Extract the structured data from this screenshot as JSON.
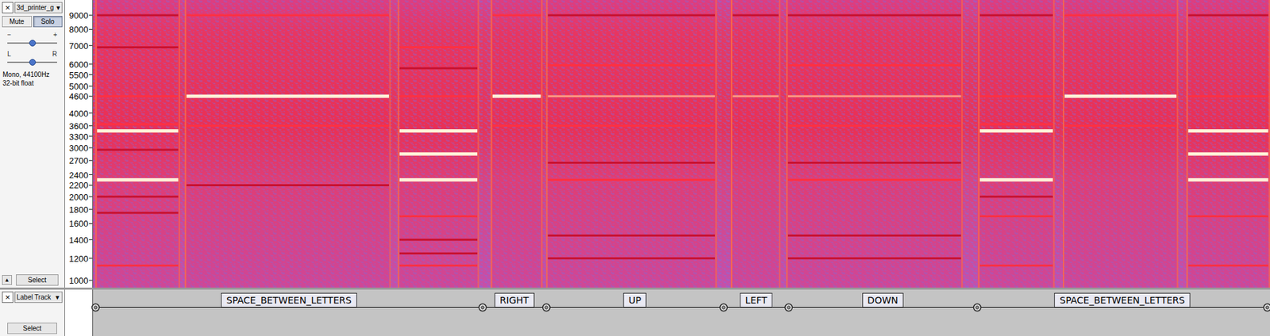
{
  "audio_track": {
    "close": "×",
    "name": "3d_printer_g",
    "menu_icon": "▼",
    "buttons": [
      {
        "label": "Mute",
        "selected": false
      },
      {
        "label": "Solo",
        "selected": true
      }
    ],
    "gain": {
      "min": "−",
      "max": "+",
      "level": 0.5
    },
    "pan": {
      "min": "L",
      "max": "R",
      "level": 0.5
    },
    "info": [
      "Mono, 44100Hz",
      "32-bit float"
    ],
    "collapse": "▲",
    "select": "Select",
    "ruler": {
      "ticks": [
        "9000",
        "8000",
        "7000",
        "6000",
        "5500",
        "5000",
        "4600",
        "4000",
        "3600",
        "3300",
        "3000",
        "2700",
        "2400",
        "2200",
        "2000",
        "1800",
        "1600",
        "1400",
        "1200",
        "1000"
      ]
    },
    "spectrogram": {
      "segments": [
        {
          "start": 0.002,
          "end": 0.074,
          "tones": [
            {
              "hz": 2300,
              "level": 1
            },
            {
              "hz": 3450,
              "level": 0.9
            },
            {
              "hz": 1130,
              "level": 0.55
            },
            {
              "hz": 4600,
              "level": 0.5
            },
            {
              "hz": 3650,
              "level": 0.45
            },
            {
              "hz": 2000,
              "level": 0.35
            },
            {
              "hz": 1750,
              "level": 0.35
            },
            {
              "hz": 2950,
              "level": 0.35
            },
            {
              "hz": 6900,
              "level": 0.35
            },
            {
              "hz": 9000,
              "level": 0.3
            }
          ]
        },
        {
          "start": 0.078,
          "end": 0.253,
          "tones": [
            {
              "hz": 4600,
              "level": 0.95
            },
            {
              "hz": 3600,
              "level": 0.5
            },
            {
              "hz": 9000,
              "level": 0.45
            },
            {
              "hz": 2200,
              "level": 0.3
            }
          ]
        },
        {
          "start": 0.259,
          "end": 0.328,
          "tones": [
            {
              "hz": 2300,
              "level": 1
            },
            {
              "hz": 2850,
              "level": 0.95
            },
            {
              "hz": 3450,
              "level": 0.9
            },
            {
              "hz": 1130,
              "level": 0.55
            },
            {
              "hz": 1700,
              "level": 0.4
            },
            {
              "hz": 1400,
              "level": 0.35
            },
            {
              "hz": 1250,
              "level": 0.35
            },
            {
              "hz": 4600,
              "level": 0.5
            },
            {
              "hz": 6900,
              "level": 0.4
            },
            {
              "hz": 5800,
              "level": 0.35
            }
          ]
        },
        {
          "start": 0.338,
          "end": 0.382,
          "tones": [
            {
              "hz": 4600,
              "level": 0.85
            },
            {
              "hz": 9000,
              "level": 0.4
            },
            {
              "hz": 3600,
              "level": 0.4
            }
          ]
        },
        {
          "start": 0.385,
          "end": 0.53,
          "tones": [
            {
              "hz": 4600,
              "level": 0.6
            },
            {
              "hz": 3600,
              "level": 0.5
            },
            {
              "hz": 5950,
              "level": 0.45
            },
            {
              "hz": 2300,
              "level": 0.4
            },
            {
              "hz": 1450,
              "level": 0.35
            },
            {
              "hz": 1200,
              "level": 0.3
            },
            {
              "hz": 9000,
              "level": 0.35
            },
            {
              "hz": 2650,
              "level": 0.3
            }
          ]
        },
        {
          "start": 0.542,
          "end": 0.584,
          "tones": [
            {
              "hz": 4600,
              "level": 0.75
            },
            {
              "hz": 9000,
              "level": 0.35
            }
          ]
        },
        {
          "start": 0.589,
          "end": 0.739,
          "tones": [
            {
              "hz": 4600,
              "level": 0.6
            },
            {
              "hz": 3600,
              "level": 0.5
            },
            {
              "hz": 5950,
              "level": 0.45
            },
            {
              "hz": 2300,
              "level": 0.4
            },
            {
              "hz": 1450,
              "level": 0.35
            },
            {
              "hz": 1200,
              "level": 0.3
            },
            {
              "hz": 9000,
              "level": 0.35
            },
            {
              "hz": 2650,
              "level": 0.3
            }
          ]
        },
        {
          "start": 0.752,
          "end": 0.817,
          "tones": [
            {
              "hz": 2300,
              "level": 1
            },
            {
              "hz": 3450,
              "level": 0.9
            },
            {
              "hz": 1700,
              "level": 0.5
            },
            {
              "hz": 1130,
              "level": 0.55
            },
            {
              "hz": 4600,
              "level": 0.45
            },
            {
              "hz": 3650,
              "level": 0.45
            },
            {
              "hz": 2000,
              "level": 0.35
            },
            {
              "hz": 9000,
              "level": 0.35
            }
          ]
        },
        {
          "start": 0.824,
          "end": 0.922,
          "tones": [
            {
              "hz": 4600,
              "level": 0.9
            },
            {
              "hz": 9000,
              "level": 0.45
            },
            {
              "hz": 3600,
              "level": 0.4
            }
          ]
        },
        {
          "start": 0.929,
          "end": 1.0,
          "tones": [
            {
              "hz": 2300,
              "level": 1
            },
            {
              "hz": 2850,
              "level": 0.95
            },
            {
              "hz": 3450,
              "level": 0.9
            },
            {
              "hz": 1130,
              "level": 0.55
            },
            {
              "hz": 1700,
              "level": 0.4
            },
            {
              "hz": 4600,
              "level": 0.5
            },
            {
              "hz": 9000,
              "level": 0.3
            }
          ]
        }
      ]
    }
  },
  "label_track": {
    "close": "×",
    "name": "Label Track",
    "menu_icon": "▼",
    "select": "Select",
    "labels": [
      {
        "text": "SPACE_BETWEEN_LETTERS",
        "start": 0.002,
        "end": 0.331
      },
      {
        "text": "RIGHT",
        "start": 0.331,
        "end": 0.385
      },
      {
        "text": "UP",
        "start": 0.385,
        "end": 0.536
      },
      {
        "text": "LEFT",
        "start": 0.536,
        "end": 0.591
      },
      {
        "text": "DOWN",
        "start": 0.591,
        "end": 0.751
      },
      {
        "text": "SPACE_BETWEEN_LETTERS",
        "start": 0.751,
        "end": 0.998
      }
    ]
  }
}
